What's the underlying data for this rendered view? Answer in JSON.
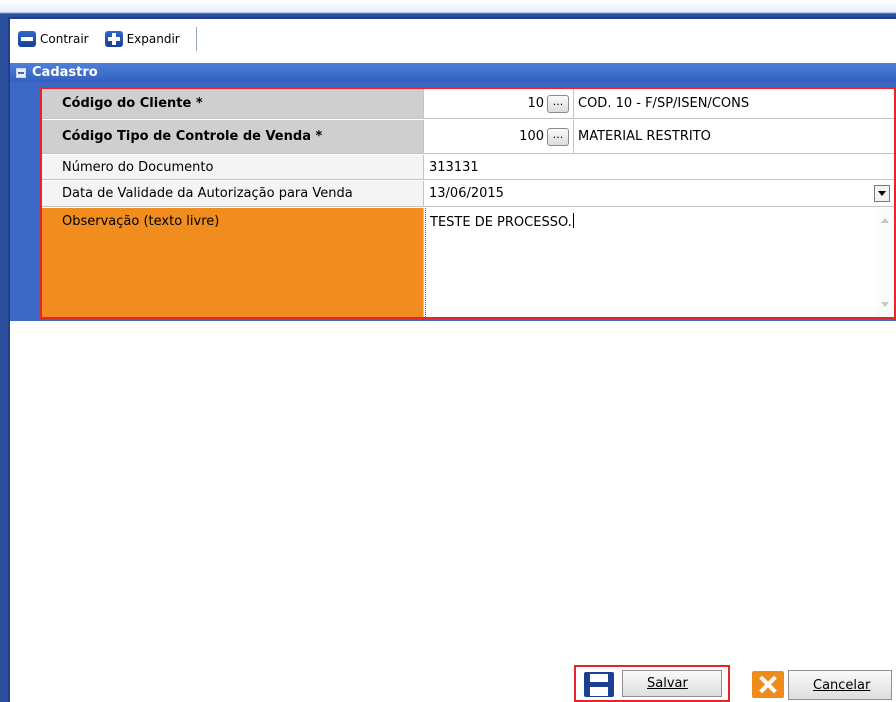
{
  "toolbar": {
    "collapse_label": "Contrair",
    "expand_label": "Expandir"
  },
  "section": {
    "title": "Cadastro"
  },
  "fields": {
    "cliente": {
      "label": "Código do Cliente *",
      "code": "10",
      "button": "...",
      "description": "COD. 10 - F/SP/ISEN/CONS"
    },
    "tipo_controle": {
      "label": "Código Tipo de Controle de Venda *",
      "code": "100",
      "button": "...",
      "description": "MATERIAL RESTRITO"
    },
    "numero_documento": {
      "label": "Número do Documento",
      "value": "313131"
    },
    "data_validade": {
      "label": "Data de Validade da Autorização para Venda",
      "value": "13/06/2015"
    },
    "observacao": {
      "label": "Observação (texto livre)",
      "value": "TESTE DE PROCESSO."
    }
  },
  "buttons": {
    "save_label": "Salvar",
    "cancel_label": "Cancelar"
  },
  "colors": {
    "window_border": "#1f3f8f",
    "section_header": "#3a68c4",
    "highlight_border": "#e8232a",
    "required_label_bg": "#cfcfcf",
    "focused_label_bg": "#f08d1e",
    "cancel_icon": "#ef8b1b"
  },
  "icons": {
    "collapse": "minus-icon",
    "expand": "plus-icon",
    "section_toggle": "collapse-box-icon",
    "save": "save-icon",
    "cancel": "close-icon"
  }
}
